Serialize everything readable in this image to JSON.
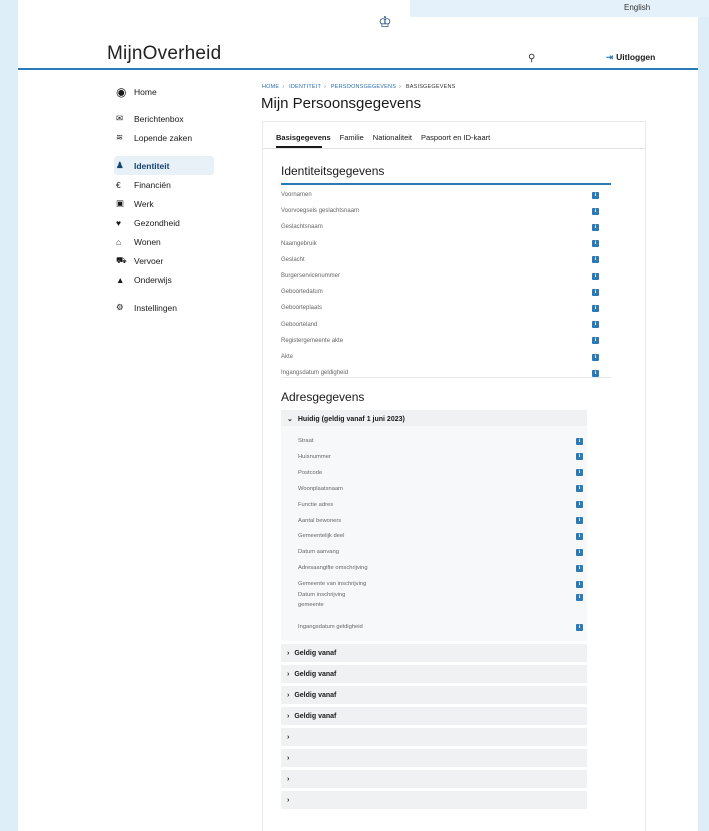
{
  "header": {
    "language": "English",
    "brand": "MijnOverheid",
    "logout_label": "Uitloggen"
  },
  "sidebar": {
    "items": [
      {
        "label": "Home",
        "icon": "home-icon"
      },
      {
        "label": "Berichtenbox",
        "icon": "envelope-icon"
      },
      {
        "label": "Lopende zaken",
        "icon": "layers-icon"
      },
      {
        "label": "Identiteit",
        "icon": "person-icon",
        "active": true
      },
      {
        "label": "Financiën",
        "icon": "euro-icon"
      },
      {
        "label": "Werk",
        "icon": "briefcase-icon"
      },
      {
        "label": "Gezondheid",
        "icon": "heart-icon"
      },
      {
        "label": "Wonen",
        "icon": "house-icon"
      },
      {
        "label": "Vervoer",
        "icon": "car-icon"
      },
      {
        "label": "Onderwijs",
        "icon": "graduation-cap-icon"
      },
      {
        "label": "Instellingen",
        "icon": "gear-icon"
      }
    ]
  },
  "breadcrumb": [
    "HOME",
    "IDENTITEIT",
    "PERSOONSGEGEVENS",
    "BASISGEGEVENS"
  ],
  "page_title": "Mijn Persoonsgegevens",
  "tabs": [
    "Basisgegevens",
    "Familie",
    "Nationaliteit",
    "Paspoort en ID-kaart"
  ],
  "identiteit": {
    "title": "Identiteitsgegevens",
    "fields": [
      "Voornamen",
      "Voorvoegsels geslachtsnaam",
      "Geslachtsnaam",
      "Naamgebruik",
      "Geslacht",
      "Burgerservicenummer",
      "Geboortedatum",
      "Geboorteplaats",
      "Geboorteland",
      "Registergemeente akte",
      "Akte",
      "Ingangsdatum geldigheid"
    ]
  },
  "adres": {
    "title": "Adresgegevens",
    "current_label": "Huidig (geldig vanaf 1 juni 2023)",
    "fields": [
      "Straat",
      "Huisnummer",
      "Postcode",
      "Woonplaatsnaam",
      "Functie adres",
      "Aantal bewoners",
      "Gemeentelijk deel",
      "Datum aanvang",
      "Adresaangifte omschrijving",
      "Gemeente van inschrijving",
      "Datum inschrijving gemeente",
      "Ingangsdatum geldigheid"
    ],
    "history": [
      "Geldig vanaf",
      "Geldig vanaf",
      "Geldig vanaf",
      "Geldig vanaf",
      "",
      "",
      "",
      ""
    ]
  },
  "colors": {
    "accent": "#2a7ab8",
    "brand": "#154273"
  }
}
